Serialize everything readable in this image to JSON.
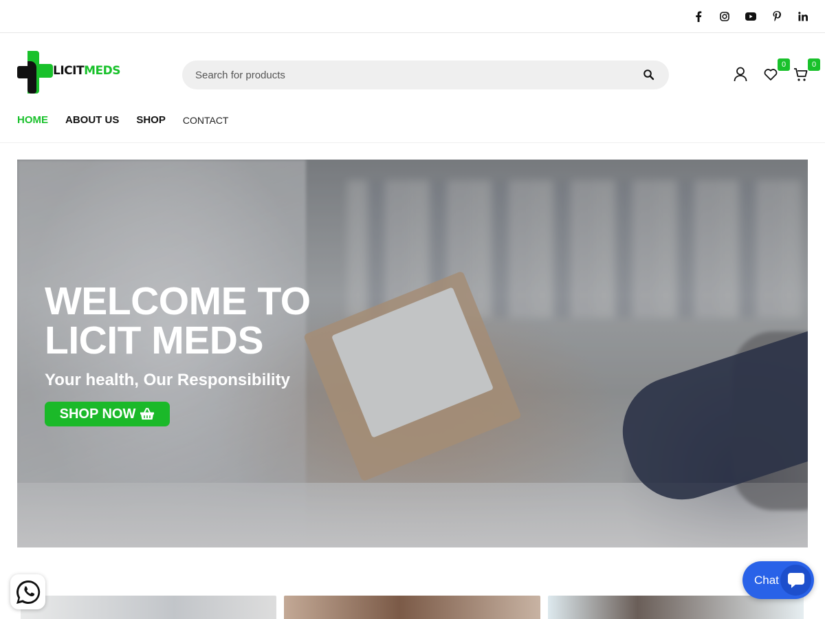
{
  "social": {
    "items": [
      {
        "name": "facebook-icon"
      },
      {
        "name": "instagram-icon"
      },
      {
        "name": "youtube-icon"
      },
      {
        "name": "pinterest-icon"
      },
      {
        "name": "linkedin-icon"
      }
    ]
  },
  "header": {
    "logo": {
      "part1": "LICIT",
      "part2": "MEDS"
    },
    "search": {
      "placeholder": "Search for products"
    },
    "wishlist_count": "0",
    "cart_count": "0"
  },
  "nav": {
    "items": [
      {
        "label": "HOME"
      },
      {
        "label": "ABOUT US"
      },
      {
        "label": "SHOP"
      },
      {
        "label": "CONTACT"
      }
    ]
  },
  "hero": {
    "title": "WELCOME TO\nLICIT MEDS",
    "subtitle": "Your health, Our Responsibility",
    "button_label": "SHOP NOW"
  },
  "chat": {
    "label": "Chat"
  },
  "colors": {
    "accent": "#19c12b",
    "chat": "#2962e8"
  }
}
